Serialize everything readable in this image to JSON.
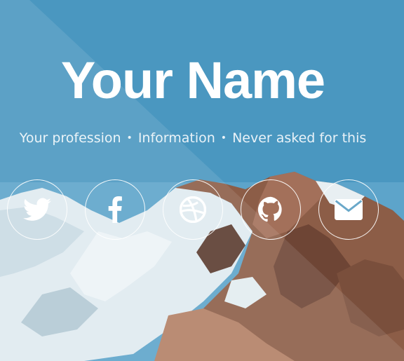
{
  "hero": {
    "title": "Your Name",
    "subtitle_items": [
      "Your profession",
      "Information",
      "Never asked for this"
    ],
    "separator": "•"
  },
  "socials": [
    {
      "icon": "twitter-icon"
    },
    {
      "icon": "facebook-icon"
    },
    {
      "icon": "dribbble-icon"
    },
    {
      "icon": "github-icon"
    },
    {
      "icon": "email-icon"
    }
  ],
  "colors": {
    "text": "#ffffff",
    "sky": "#4a97c0",
    "snow": "#e4eef2",
    "rock": "#8a5a44"
  }
}
